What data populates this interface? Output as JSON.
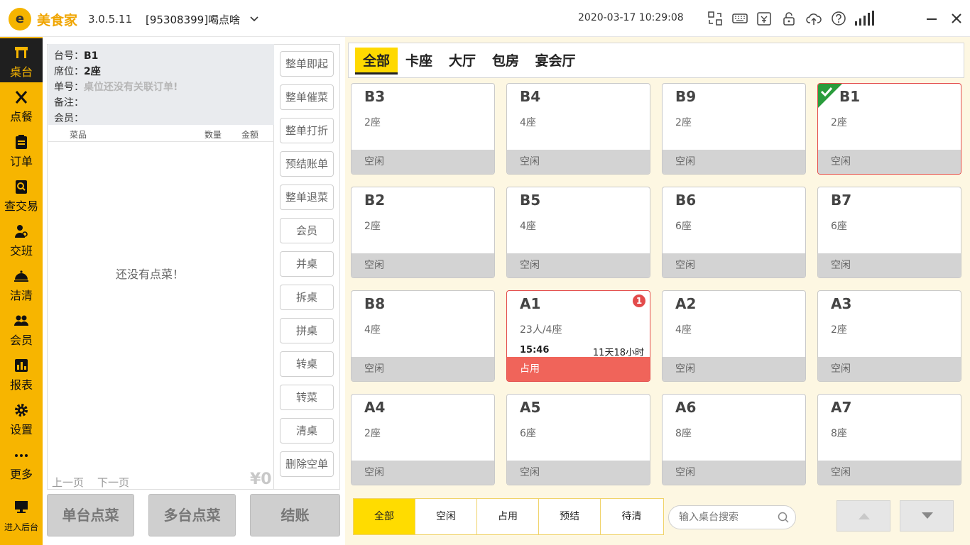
{
  "titlebar": {
    "logo_text": "e",
    "app_name": "美食家",
    "version": "3.0.5.11",
    "shop": "[95308399]喝点啥",
    "datetime": "2020-03-17 10:29:08"
  },
  "sidebar": {
    "items": [
      {
        "label": "桌台"
      },
      {
        "label": "点餐"
      },
      {
        "label": "订单"
      },
      {
        "label": "查交易"
      },
      {
        "label": "交班"
      },
      {
        "label": "洁清"
      },
      {
        "label": "会员"
      },
      {
        "label": "报表"
      },
      {
        "label": "设置"
      },
      {
        "label": "更多"
      },
      {
        "label": "进入后台"
      }
    ]
  },
  "order": {
    "table_label": "台号：",
    "table_value": "B1",
    "seat_label": "席位：",
    "seat_value": "2座",
    "order_label": "单号：",
    "order_value": "桌位还没有关联订单!",
    "note_label": "备注：",
    "member_label": "会员：",
    "col_dish": "菜品",
    "col_qty": "数量",
    "col_amount": "金额",
    "empty_tip": "还没有点菜！",
    "prev_page": "上一页",
    "next_page": "下一页",
    "total": "¥0"
  },
  "actions": [
    "整单即起",
    "整单催菜",
    "整单打折",
    "预结账单",
    "整单退菜",
    "会员",
    "并桌",
    "拆桌",
    "拼桌",
    "转桌",
    "转菜",
    "清桌",
    "删除空单"
  ],
  "bottom_buttons": {
    "single": "单台点菜",
    "multi": "多台点菜",
    "checkout": "结账"
  },
  "zones": [
    "全部",
    "卡座",
    "大厅",
    "包房",
    "宴会厅"
  ],
  "tables": [
    {
      "name": "B3",
      "seats": "2座",
      "status": "空闲"
    },
    {
      "name": "B4",
      "seats": "4座",
      "status": "空闲"
    },
    {
      "name": "B9",
      "seats": "2座",
      "status": "空闲"
    },
    {
      "name": "B1",
      "seats": "2座",
      "status": "空闲",
      "selected": true
    },
    {
      "name": "B2",
      "seats": "2座",
      "status": "空闲"
    },
    {
      "name": "B5",
      "seats": "4座",
      "status": "空闲"
    },
    {
      "name": "B6",
      "seats": "6座",
      "status": "空闲"
    },
    {
      "name": "B7",
      "seats": "6座",
      "status": "空闲"
    },
    {
      "name": "B8",
      "seats": "4座",
      "status": "空闲"
    },
    {
      "name": "A1",
      "seats": "23人/4座",
      "status": "占用",
      "time": "15:46",
      "duration": "11天18小时",
      "badge": "1"
    },
    {
      "name": "A2",
      "seats": "4座",
      "status": "空闲"
    },
    {
      "name": "A3",
      "seats": "2座",
      "status": "空闲"
    },
    {
      "name": "A4",
      "seats": "2座",
      "status": "空闲"
    },
    {
      "name": "A5",
      "seats": "6座",
      "status": "空闲"
    },
    {
      "name": "A6",
      "seats": "8座",
      "status": "空闲"
    },
    {
      "name": "A7",
      "seats": "8座",
      "status": "空闲"
    }
  ],
  "filters": [
    "全部",
    "空闲",
    "占用",
    "预结",
    "待清"
  ],
  "search": {
    "placeholder": "输入桌台搜索"
  },
  "colors": {
    "brand": "#f7b500",
    "busy": "#f0645a",
    "selected": "#e34b4b",
    "active_tab": "#ffd900"
  }
}
